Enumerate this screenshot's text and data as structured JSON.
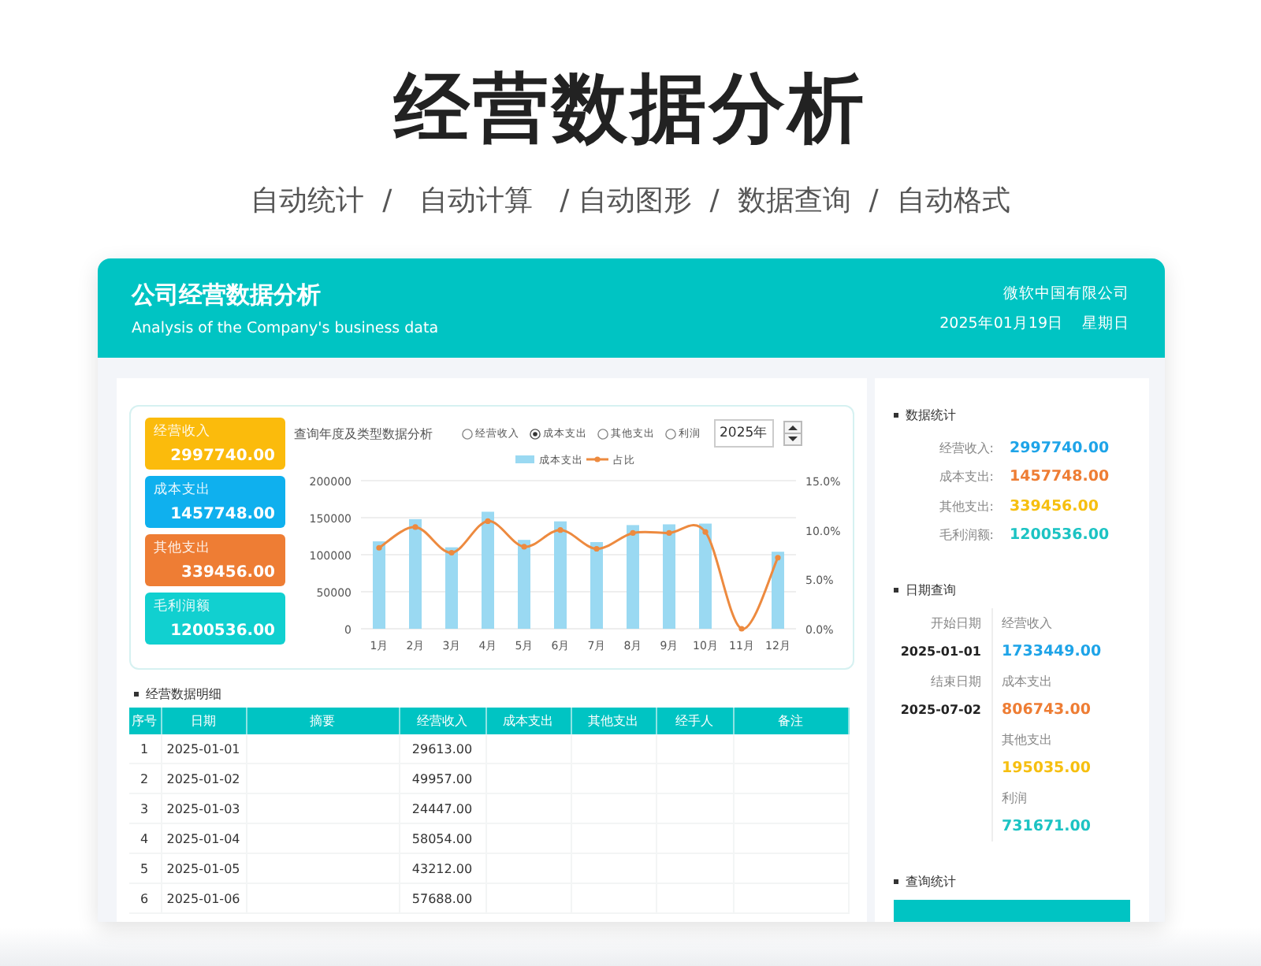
{
  "page_title": "经营数据分析",
  "page_subtitle": "自动统计  /   自动计算   / 自动图形  /  数据查询  /  自动格式",
  "header": {
    "title": "公司经营数据分析",
    "subtitle": "Analysis of the Company's business data",
    "company": "微软中国有限公司",
    "date": "2025年01月19日",
    "weekday": "星期日"
  },
  "kpis": [
    {
      "label": "经营收入",
      "value": "2997740.00",
      "color": "#fbbb0c"
    },
    {
      "label": "成本支出",
      "value": "1457748.00",
      "color": "#0fb0ee"
    },
    {
      "label": "其他支出",
      "value": "339456.00",
      "color": "#ee7d34"
    },
    {
      "label": "毛利润额",
      "value": "1200536.00",
      "color": "#11d0d0"
    }
  ],
  "chart_panel": {
    "title": "查询年度及类型数据分析",
    "options": [
      {
        "label": "经营收入",
        "selected": false
      },
      {
        "label": "成本支出",
        "selected": true
      },
      {
        "label": "其他支出",
        "selected": false
      },
      {
        "label": "利润",
        "selected": false
      }
    ],
    "year": "2025年",
    "chart_data": {
      "type": "bar",
      "categories": [
        "1月",
        "2月",
        "3月",
        "4月",
        "5月",
        "6月",
        "7月",
        "8月",
        "9月",
        "10月",
        "11月",
        "12月"
      ],
      "series": [
        {
          "name": "成本支出",
          "color": "#9ad9f2",
          "values": [
            118000,
            148000,
            110000,
            158000,
            120000,
            145000,
            117000,
            140000,
            141000,
            142000,
            0,
            104000
          ]
        },
        {
          "name": "占比",
          "type": "line",
          "axis": "y2",
          "marker": "o",
          "color": "#ed8a3f",
          "values": [
            0.082,
            0.103,
            0.077,
            0.109,
            0.083,
            0.1,
            0.081,
            0.097,
            0.097,
            0.098,
            0,
            0.072
          ]
        }
      ],
      "ylim": [
        0,
        200000
      ],
      "y2lim": [
        0,
        0.15
      ],
      "grid": true,
      "legend": "top",
      "yticks": [
        0,
        50000,
        100000,
        150000,
        200000
      ],
      "y2ticks": [
        {
          "value": 0,
          "label": "0.0%"
        },
        {
          "value": 0.05,
          "label": "5.0%"
        },
        {
          "value": 0.1,
          "label": "10.0%"
        },
        {
          "value": 0.15,
          "label": "15.0%"
        }
      ]
    }
  },
  "detail": {
    "title": "经营数据明细",
    "columns": [
      "序号",
      "日期",
      "摘要",
      "经营收入",
      "成本支出",
      "其他支出",
      "经手人",
      "备注"
    ],
    "rows": [
      {
        "no": "1",
        "date": "2025-01-01",
        "income": "29613.00"
      },
      {
        "no": "2",
        "date": "2025-01-02",
        "income": "49957.00"
      },
      {
        "no": "3",
        "date": "2025-01-03",
        "income": "24447.00"
      },
      {
        "no": "4",
        "date": "2025-01-04",
        "income": "58054.00"
      },
      {
        "no": "5",
        "date": "2025-01-05",
        "income": "43212.00"
      },
      {
        "no": "6",
        "date": "2025-01-06",
        "income": "57688.00"
      }
    ]
  },
  "stats": {
    "title": "数据统计",
    "items": [
      {
        "label": "经营收入:",
        "value": "2997740.00",
        "color": "#1ea4e8"
      },
      {
        "label": "成本支出:",
        "value": "1457748.00",
        "color": "#ee7d34"
      },
      {
        "label": "其他支出:",
        "value": "339456.00",
        "color": "#f6bf10"
      },
      {
        "label": "毛利润额:",
        "value": "1200536.00",
        "color": "#1cc3c3"
      }
    ]
  },
  "date_query": {
    "title": "日期查询",
    "start_label": "开始日期",
    "start_date": "2025-01-01",
    "end_label": "结束日期",
    "end_date": "2025-07-02",
    "metrics": [
      {
        "label": "经营收入",
        "value": "1733449.00",
        "color": "#1ea4e8"
      },
      {
        "label": "成本支出",
        "value": "806743.00",
        "color": "#ee7d34"
      },
      {
        "label": "其他支出",
        "value": "195035.00",
        "color": "#f6bf10"
      },
      {
        "label": "利润",
        "value": "731671.00",
        "color": "#1cc3c3"
      }
    ]
  },
  "query_stats": {
    "title": "查询统计"
  }
}
